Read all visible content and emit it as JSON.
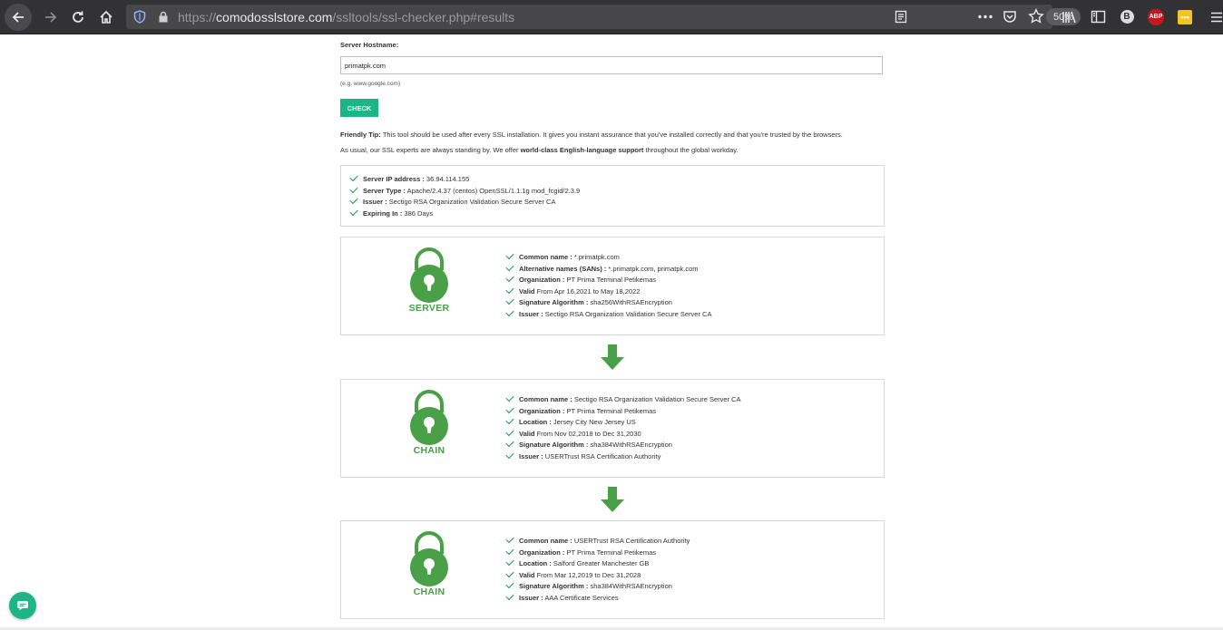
{
  "browser": {
    "url_host": "comodosslstore.com",
    "url_scheme": "https://",
    "url_path": "/ssltools/ssl-checker.php#results",
    "zoom": "50%",
    "abp_label": "ABP",
    "profile_letter": "B"
  },
  "form": {
    "hostname_label": "Server Hostname:",
    "hostname_value": "primatpk.com",
    "example": "(e.g. www.google.com)",
    "check_label": "CHECK"
  },
  "tips": {
    "tip_bold": "Friendly Tip:",
    "tip_text": " This tool should be used after every SSL installation. It gives you instant assurance that you've installed correctly and that you're trusted by the browsers.",
    "support_pre": "As usual, our SSL experts are always standing by. We offer ",
    "support_bold": "world-class English-language support",
    "support_post": " throughout the global workday."
  },
  "summary": [
    {
      "label": "Server IP address :",
      "value": " 36.94.114.155"
    },
    {
      "label": "Server Type :",
      "value": " Apache/2.4.37 (centos) OpenSSL/1.1.1g mod_fcgid/2.3.9"
    },
    {
      "label": "Issuer :",
      "value": " Sectigo RSA Organization Validation Secure Server CA"
    },
    {
      "label": "Expiring In :",
      "value": " 386 Days"
    }
  ],
  "certs": [
    {
      "label": "SERVER",
      "fields": [
        {
          "label": "Common name :",
          "value": " *.primatpk.com"
        },
        {
          "label": "Alternative names (SANs) :",
          "value": " *.primatpk.com, primatpk.com"
        },
        {
          "label": "Organization :",
          "value": " PT Prima Terminal Petikemas"
        },
        {
          "label": "Valid",
          "value": " From Apr 16,2021 to May 18,2022"
        },
        {
          "label": "Signature Algorithm :",
          "value": " sha256WithRSAEncryption"
        },
        {
          "label": "Issuer :",
          "value": " Sectigo RSA Organization Validation Secure Server CA"
        }
      ]
    },
    {
      "label": "CHAIN",
      "fields": [
        {
          "label": "Common name :",
          "value": " Sectigo RSA Organization Validation Secure Server CA"
        },
        {
          "label": "Organization :",
          "value": " PT Prima Terminal Petikemas"
        },
        {
          "label": "Location :",
          "value": " Jersey City New Jersey US"
        },
        {
          "label": "Valid",
          "value": " From Nov 02,2018 to Dec 31,2030"
        },
        {
          "label": "Signature Algorithm :",
          "value": " sha384WithRSAEncryption"
        },
        {
          "label": "Issuer :",
          "value": " USERTrust RSA Certification Authority"
        }
      ]
    },
    {
      "label": "CHAIN",
      "fields": [
        {
          "label": "Common name :",
          "value": " USERTrust RSA Certification Authority"
        },
        {
          "label": "Organization :",
          "value": " PT Prima Terminal Petikemas"
        },
        {
          "label": "Location :",
          "value": " Salford Greater Manchester GB"
        },
        {
          "label": "Valid",
          "value": " From Mar 12,2019 to Dec 31,2028"
        },
        {
          "label": "Signature Algorithm :",
          "value": " sha384WithRSAEncryption"
        },
        {
          "label": "Issuer :",
          "value": " AAA Certificate Services"
        }
      ]
    }
  ],
  "colors": {
    "accent_green": "#49a047",
    "button_teal": "#1db585",
    "toolbar": "#323234"
  }
}
